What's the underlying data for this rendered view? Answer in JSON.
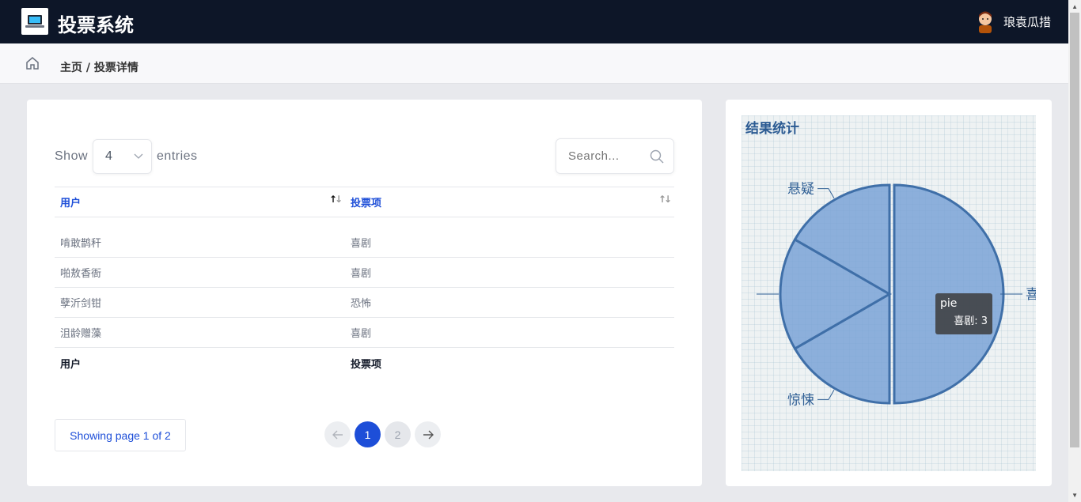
{
  "header": {
    "brand": "投票系统",
    "username": "琅袁瓜措",
    "icons": {
      "logo": "laptop-icon",
      "avatar": "user-avatar-icon"
    }
  },
  "breadcrumb": {
    "home_icon": "home-icon",
    "text": "主页 / 投票详情"
  },
  "table_controls": {
    "show_label": "Show",
    "entries_value": "4",
    "entries_label": "entries",
    "search_placeholder": "Search..."
  },
  "table": {
    "columns": [
      "用户",
      "投票项"
    ],
    "rows": [
      [
        "啃敢鹊秆",
        "喜剧"
      ],
      [
        "啪敖香衙",
        "喜剧"
      ],
      [
        "孽沂剑钳",
        "恐怖"
      ],
      [
        "沮龄赠藻",
        "喜剧"
      ]
    ],
    "footer": [
      "用户",
      "投票项"
    ]
  },
  "pagination": {
    "info": "Showing page 1 of 2",
    "prev": "←",
    "next": "→",
    "pages": [
      "1",
      "2"
    ],
    "current": 1
  },
  "chart_panel": {
    "title": "结果统计",
    "tooltip_series": "pie",
    "tooltip_value": "喜剧: 3"
  },
  "chart_data": {
    "type": "pie",
    "title": "结果统计",
    "slices": [
      {
        "label": "喜剧",
        "value": 3
      },
      {
        "label": "惊悚",
        "value": 1
      },
      {
        "label": "",
        "value": 1
      },
      {
        "label": "悬疑",
        "value": 1
      }
    ],
    "colors": {
      "fill": "#7aa3d6",
      "stroke": "#3f6fa8"
    }
  }
}
